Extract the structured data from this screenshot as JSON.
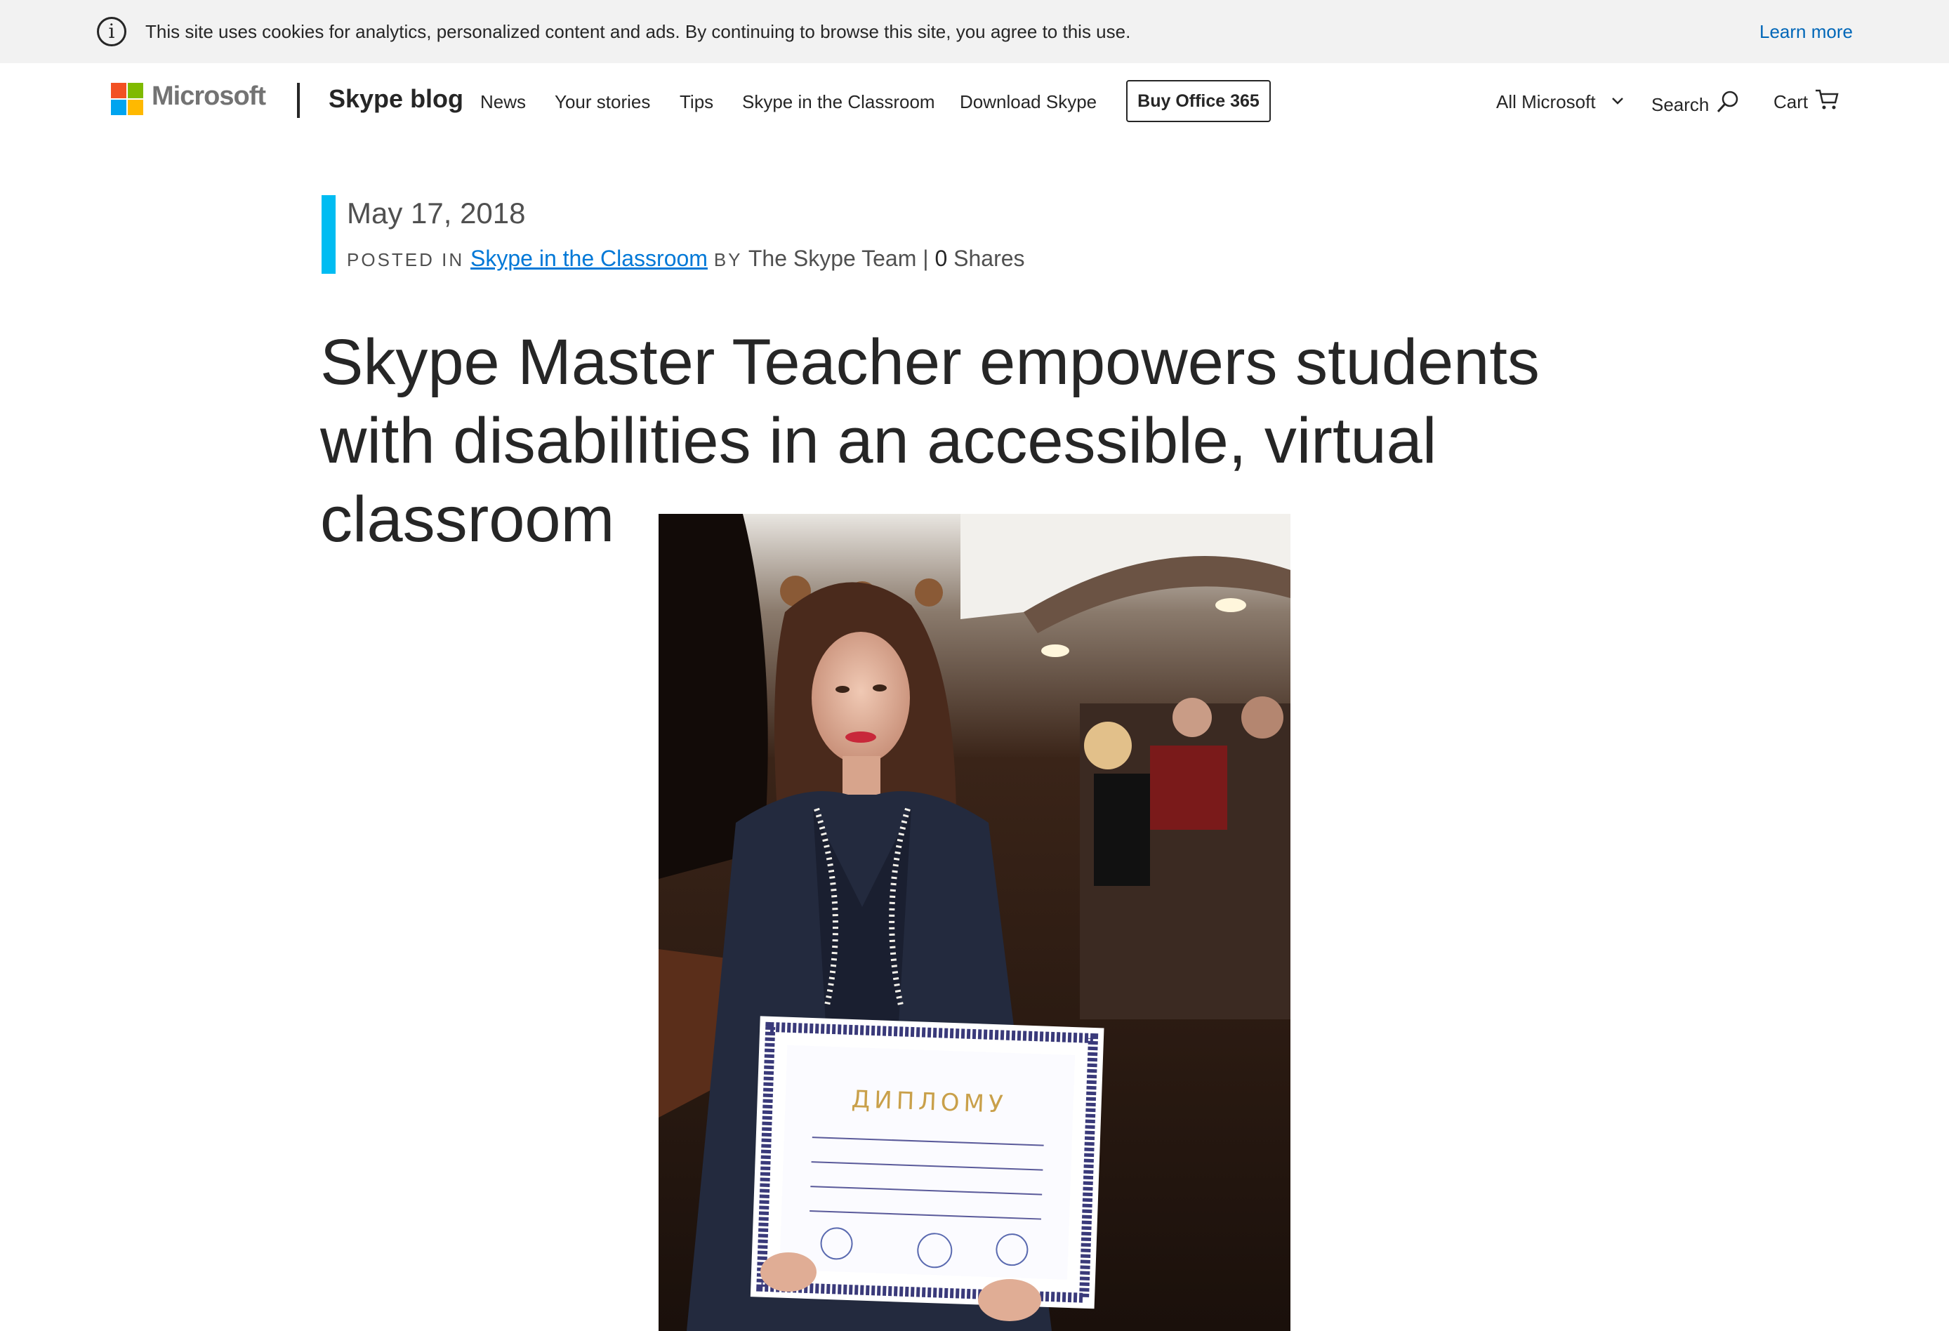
{
  "cookie_bar": {
    "message": "This site uses cookies for analytics, personalized content and ads. By continuing to browse this site, you agree to this use.",
    "learn_more": "Learn more",
    "info_glyph": "i"
  },
  "header": {
    "brand": "Microsoft",
    "blog_title": "Skype blog",
    "nav": [
      "News",
      "Your stories",
      "Tips",
      "Skype in the Classroom",
      "Download Skype"
    ],
    "buy_button": "Buy Office 365",
    "all_microsoft": "All Microsoft",
    "search": "Search",
    "cart": "Cart"
  },
  "post": {
    "date": "May 17, 2018",
    "posted_in": "POSTED IN",
    "category": "Skype in the Classroom",
    "by": "BY",
    "author": "The Skype Team",
    "separator": "|",
    "share_count": "0",
    "shares_label": "Shares",
    "title": "Skype Master Teacher empowers students with disabilities in an accessible, virtual classroom"
  },
  "hero": {
    "alt": "Woman holding a diploma in an auditorium",
    "diploma_heading": "ДИПЛОМУ"
  },
  "colors": {
    "accent": "#00bcf2",
    "link": "#0067b8",
    "category_link": "#0078d7",
    "text": "#262626"
  }
}
